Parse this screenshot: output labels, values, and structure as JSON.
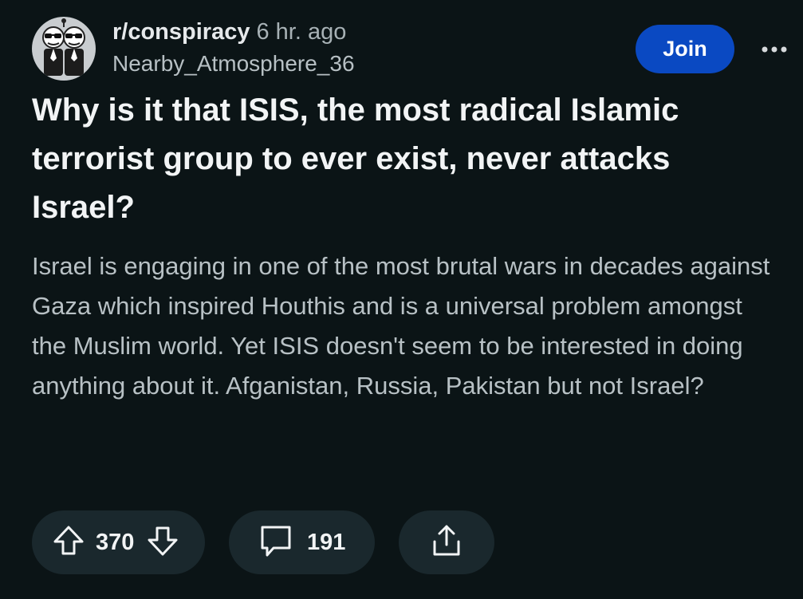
{
  "post": {
    "subreddit": "r/conspiracy",
    "time_ago": "6 hr. ago",
    "author": "Nearby_Atmosphere_36",
    "join_label": "Join",
    "title": "Why is it that ISIS, the most radical Islamic terrorist group to ever exist, never attacks Israel?",
    "body": "Israel is engaging in one of the most brutal wars in decades against Gaza which inspired Houthis and is a universal problem amongst the Muslim world. Yet ISIS doesn't seem to be interested in doing anything about it. Afganistan, Russia, Pakistan but not Israel?"
  },
  "actions": {
    "votes": "370",
    "comments": "191"
  },
  "icons": {
    "avatar": "subreddit-avatar-icon",
    "more": "more-options-icon",
    "upvote": "upvote-arrow-icon",
    "downvote": "downvote-arrow-icon",
    "comment": "comment-bubble-icon",
    "share": "share-icon"
  },
  "colors": {
    "background": "#0b1416",
    "join_button": "#0a49c2",
    "pill": "#1a282d",
    "title_text": "#f2f4f5",
    "body_text": "#b8c1c5"
  }
}
